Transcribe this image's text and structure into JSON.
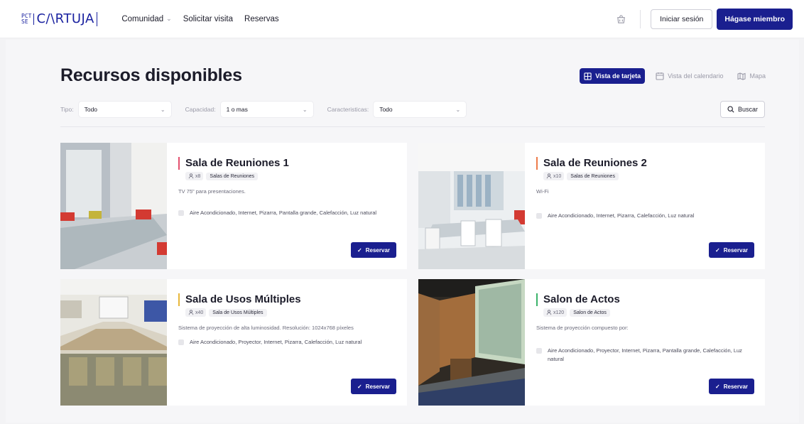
{
  "header": {
    "logo_mark": [
      "PCT",
      "SE"
    ],
    "logo_text": "C/\\RTUJA",
    "nav": [
      {
        "label": "Comunidad",
        "has_dropdown": true
      },
      {
        "label": "Solicitar visita",
        "has_dropdown": false
      },
      {
        "label": "Reservas",
        "has_dropdown": false
      }
    ],
    "cart_icon": "shopping-basket-icon",
    "login_label": "Iniciar sesión",
    "join_label": "Hágase miembro"
  },
  "page": {
    "title": "Recursos disponibles",
    "views": [
      {
        "label": "Vista de tarjeta",
        "icon": "card-grid-icon",
        "active": true
      },
      {
        "label": "Vista del calendario",
        "icon": "calendar-icon",
        "active": false
      },
      {
        "label": "Mapa",
        "icon": "map-icon",
        "active": false
      }
    ]
  },
  "filters": {
    "type_label": "Tipo:",
    "type_value": "Todo",
    "capacity_label": "Capacidad:",
    "capacity_value": "1 o mas",
    "features_label": "Caracteristicas:",
    "features_value": "Todo",
    "search_label": "Buscar"
  },
  "cards": [
    {
      "title": "Sala de Reuniones 1",
      "accent": "#e4506e",
      "capacity": "x8",
      "category": "Salas de Reuniones",
      "description": "TV 75\" para presentaciones.",
      "features": "Aire Acondicionado, Internet, Pizarra, Pantalla grande, Calefacción, Luz natural",
      "button": "Reservar"
    },
    {
      "title": "Sala de Reuniones 2",
      "accent": "#ee7b4a",
      "capacity": "x10",
      "category": "Salas de Reuniones",
      "description": "Wi-Fi",
      "features": "Aire Acondicionado, Internet, Pizarra, Calefacción, Luz natural",
      "button": "Reservar"
    },
    {
      "title": "Sala de Usos Múltiples",
      "accent": "#e8b73a",
      "capacity": "x40",
      "category": "Sala de Usos Múltiples",
      "description": "Sistema de proyección de alta luminosidad. Resolución: 1024x768 píxeles",
      "features": "Aire Acondicionado, Proyector, Internet, Pizarra, Calefacción, Luz natural",
      "button": "Reservar"
    },
    {
      "title": "Salon de Actos",
      "accent": "#3bb36a",
      "capacity": "x120",
      "category": "Salon de Actos",
      "description": "Sistema de proyección compuesto por:",
      "features": "Aire Acondicionado, Proyector, Internet, Pizarra, Pantalla grande, Calefacción, Luz natural",
      "button": "Reservar"
    }
  ],
  "colors": {
    "brand": "#1a1f8f",
    "logo": "#1a22a0"
  }
}
